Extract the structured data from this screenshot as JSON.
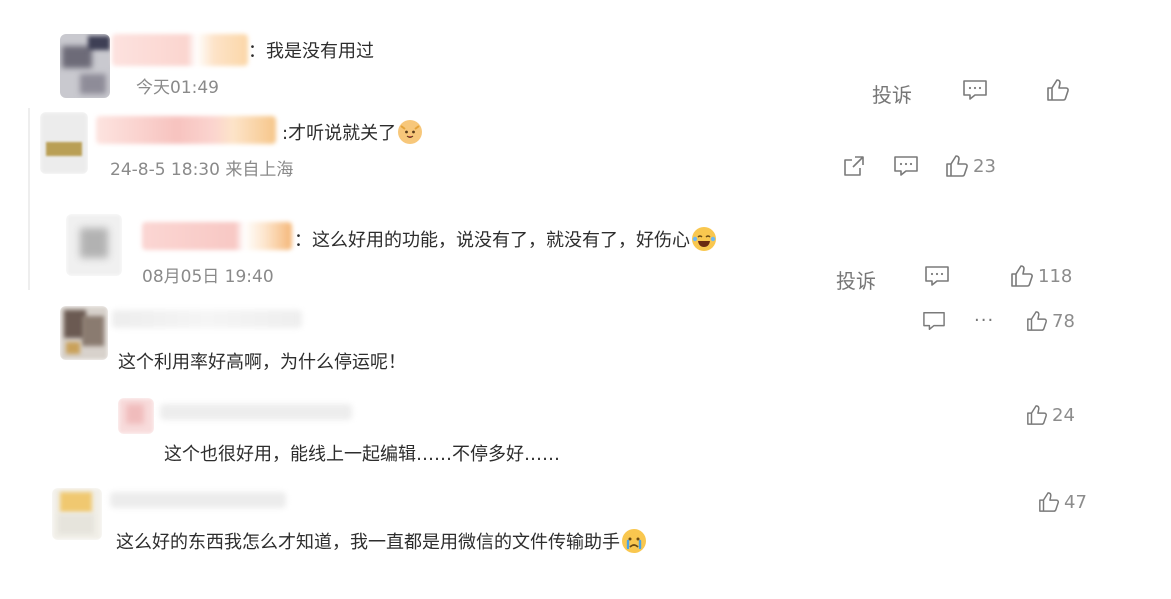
{
  "comments": [
    {
      "text": "：我是没有用过",
      "time": "今天01:49",
      "report": "投诉"
    },
    {
      "text": ":才听说就关了",
      "emoji": "cat-face",
      "time": "24-8-5 18:30 来自上海",
      "likes": "23"
    },
    {
      "text": "：这么好用的功能，说没有了，就没有了，好伤心",
      "emoji": "laughing-crying",
      "time": "08月05日 19:40",
      "report": "投诉",
      "likes": "118"
    },
    {
      "text": "这个利用率好高啊，为什么停运呢！",
      "more": "···",
      "likes": "78"
    },
    {
      "text": "这个也很好用，能线上一起编辑……不停多好……",
      "likes": "24"
    },
    {
      "text": "这么好的东西我怎么才知道，我一直都是用微信的文件传输助手",
      "emoji": "crying-face",
      "likes": "47"
    }
  ],
  "colors": {
    "text": "#2d2d2d",
    "meta": "#8a8a8a",
    "icon": "#7a7a7a"
  }
}
